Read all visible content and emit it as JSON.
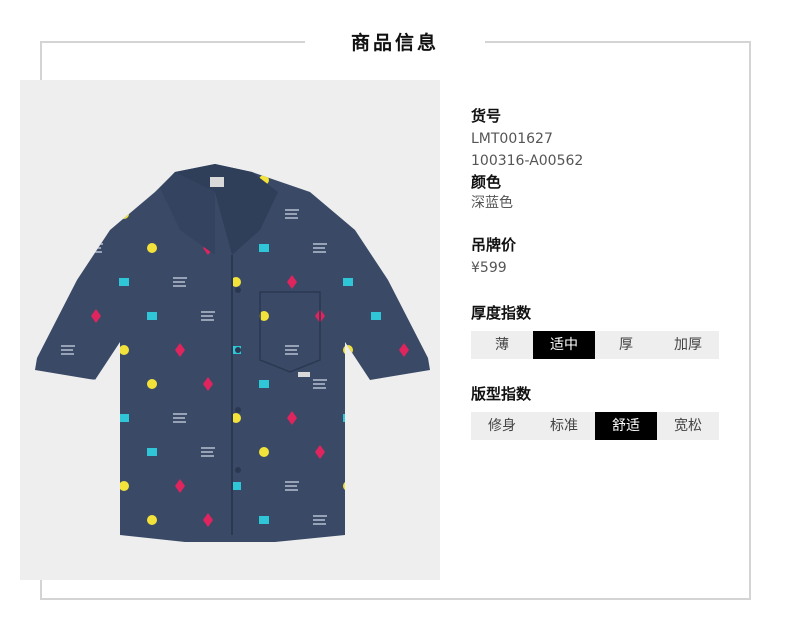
{
  "header": {
    "title": "商品信息"
  },
  "product": {
    "sku_label": "货号",
    "sku_values": [
      "LMT001627",
      "100316-A00562"
    ],
    "color_label": "颜色",
    "color_value": "深蓝色",
    "price_label": "吊牌价",
    "price_value": "¥599"
  },
  "thickness": {
    "label": "厚度指数",
    "options": [
      "薄",
      "适中",
      "厚",
      "加厚"
    ],
    "selected": "适中"
  },
  "fit": {
    "label": "版型指数",
    "options": [
      "修身",
      "标准",
      "舒适",
      "宽松"
    ],
    "selected": "舒适"
  },
  "colors": {
    "shirt": "#3a4a66",
    "print_pink": "#e0245e",
    "print_yellow": "#f2e23a",
    "print_cyan": "#2fc7d8",
    "selected_bg": "#000000",
    "segment_bg": "#eeeeee"
  }
}
